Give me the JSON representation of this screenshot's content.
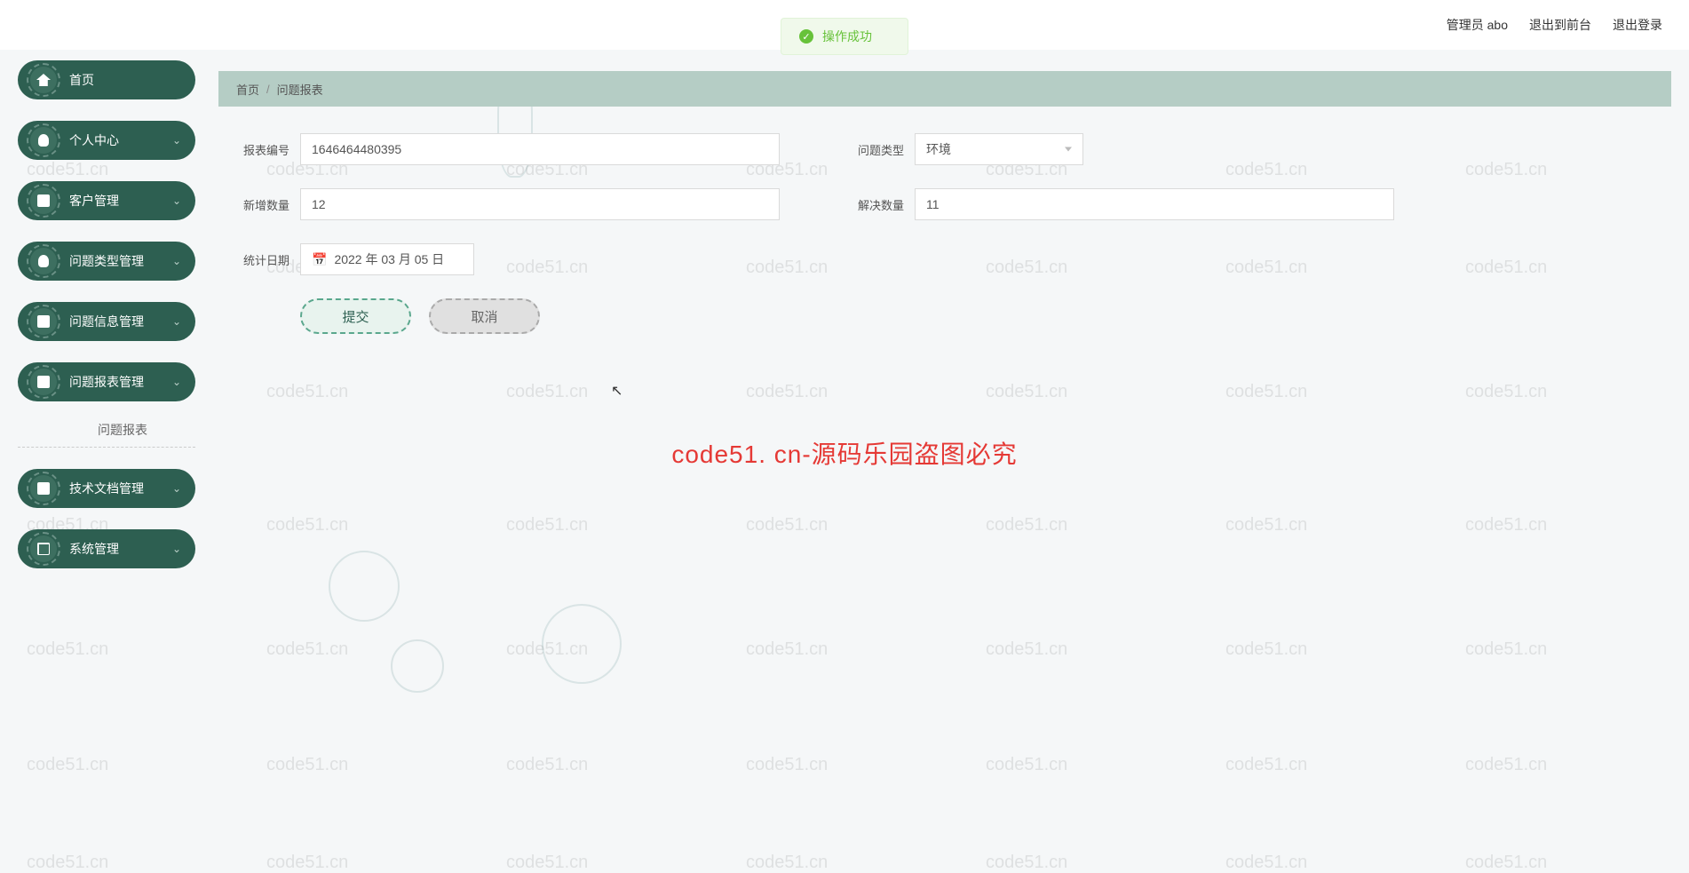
{
  "toast": {
    "message": "操作成功"
  },
  "header": {
    "user_label": "管理员 abo",
    "back_frontend": "退出到前台",
    "logout": "退出登录"
  },
  "sidebar": {
    "items": [
      {
        "label": "首页",
        "expandable": false
      },
      {
        "label": "个人中心",
        "expandable": true
      },
      {
        "label": "客户管理",
        "expandable": true
      },
      {
        "label": "问题类型管理",
        "expandable": true
      },
      {
        "label": "问题信息管理",
        "expandable": true
      },
      {
        "label": "问题报表管理",
        "expandable": true,
        "children": [
          {
            "label": "问题报表"
          }
        ]
      },
      {
        "label": "技术文档管理",
        "expandable": true
      },
      {
        "label": "系统管理",
        "expandable": true
      }
    ]
  },
  "breadcrumb": {
    "root": "首页",
    "sep": "/",
    "current": "问题报表"
  },
  "form": {
    "fields": {
      "report_id": {
        "label": "报表编号",
        "value": "1646464480395"
      },
      "problem_type": {
        "label": "问题类型",
        "value": "环境"
      },
      "new_count": {
        "label": "新增数量",
        "value": "12"
      },
      "resolved_count": {
        "label": "解决数量",
        "value": "11"
      },
      "stat_date": {
        "label": "统计日期",
        "value": "2022 年 03 月 05 日"
      }
    },
    "buttons": {
      "submit": "提交",
      "cancel": "取消"
    }
  },
  "watermark": {
    "center_text": "code51. cn-源码乐园盗图必究",
    "repeat_text": "code51.cn"
  }
}
